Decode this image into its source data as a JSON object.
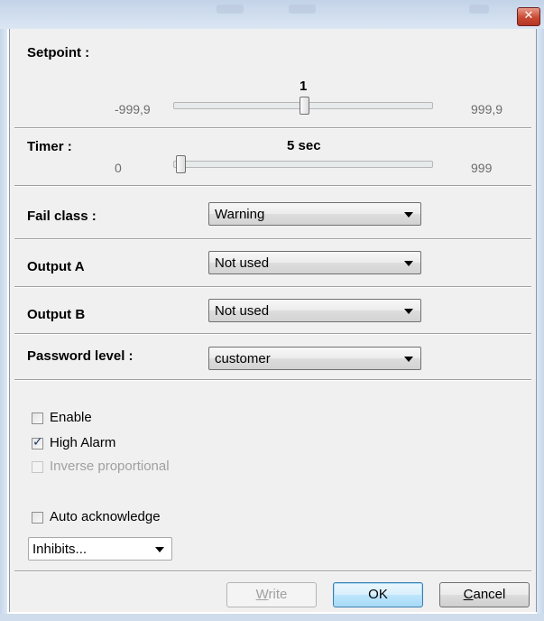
{
  "window": {
    "close_glyph": "✕"
  },
  "setpoint": {
    "label": "Setpoint :",
    "min_label": "-999,9",
    "max_label": "999,9",
    "value_label": "1",
    "min": -999.9,
    "max": 999.9,
    "value": 1
  },
  "timer": {
    "label": "Timer :",
    "min_label": "0",
    "max_label": "999",
    "value_label": "5 sec",
    "min": 0,
    "max": 999,
    "value": 5
  },
  "fail_class": {
    "label": "Fail class :",
    "selected": "Warning"
  },
  "output_a": {
    "label": "Output A",
    "selected": "Not used"
  },
  "output_b": {
    "label": "Output B",
    "selected": "Not used"
  },
  "password_level": {
    "label": "Password level :",
    "selected": "customer"
  },
  "checkboxes": {
    "enable": {
      "label": "Enable",
      "checked": false
    },
    "high_alarm": {
      "label": "High Alarm",
      "checked": true
    },
    "inverse_proportional": {
      "label": "Inverse proportional",
      "checked": false,
      "disabled": true
    },
    "auto_acknowledge": {
      "label": "Auto acknowledge",
      "checked": false
    }
  },
  "inhibits": {
    "selected": "Inhibits..."
  },
  "buttons": {
    "write": {
      "mnemonic": "W",
      "rest": "rite"
    },
    "ok": "OK",
    "cancel": {
      "mnemonic": "C",
      "rest": "ancel"
    }
  },
  "colors": {
    "close_red": "#c84a33",
    "frame_blue": "#c7d6ea",
    "check_mark": "#223a6a"
  },
  "icons": {
    "close": "close-icon",
    "dropdown": "chevron-down-icon",
    "check": "checkmark-icon"
  }
}
